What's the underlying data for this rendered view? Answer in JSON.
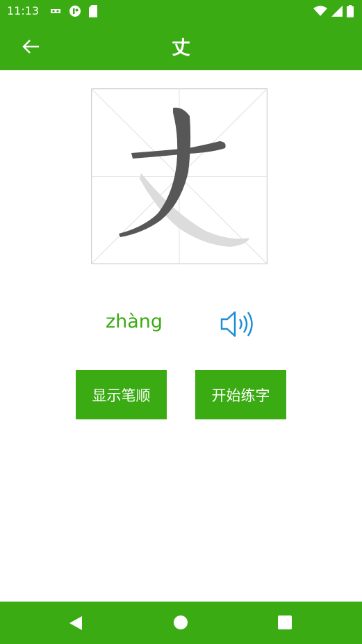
{
  "status_bar": {
    "time": "11:13",
    "left_icons": [
      "android-debug-icon",
      "app-notification-icon",
      "sd-card-icon"
    ],
    "right_icons": [
      "wifi-icon",
      "signal-icon",
      "battery-icon"
    ]
  },
  "app_bar": {
    "title": "丈",
    "back_icon": "arrow-left-icon",
    "color": "#3aab12"
  },
  "character_card": {
    "character": "丈",
    "ghost_character": "丈"
  },
  "pinyin": {
    "text": "zhàng",
    "audio_icon": "speaker-icon"
  },
  "actions": {
    "show_stroke_order": "显示笔顺",
    "start_practice": "开始练字"
  },
  "nav_bar": {
    "back": "nav-back-icon",
    "home": "nav-home-icon",
    "recent": "nav-recent-icon"
  }
}
